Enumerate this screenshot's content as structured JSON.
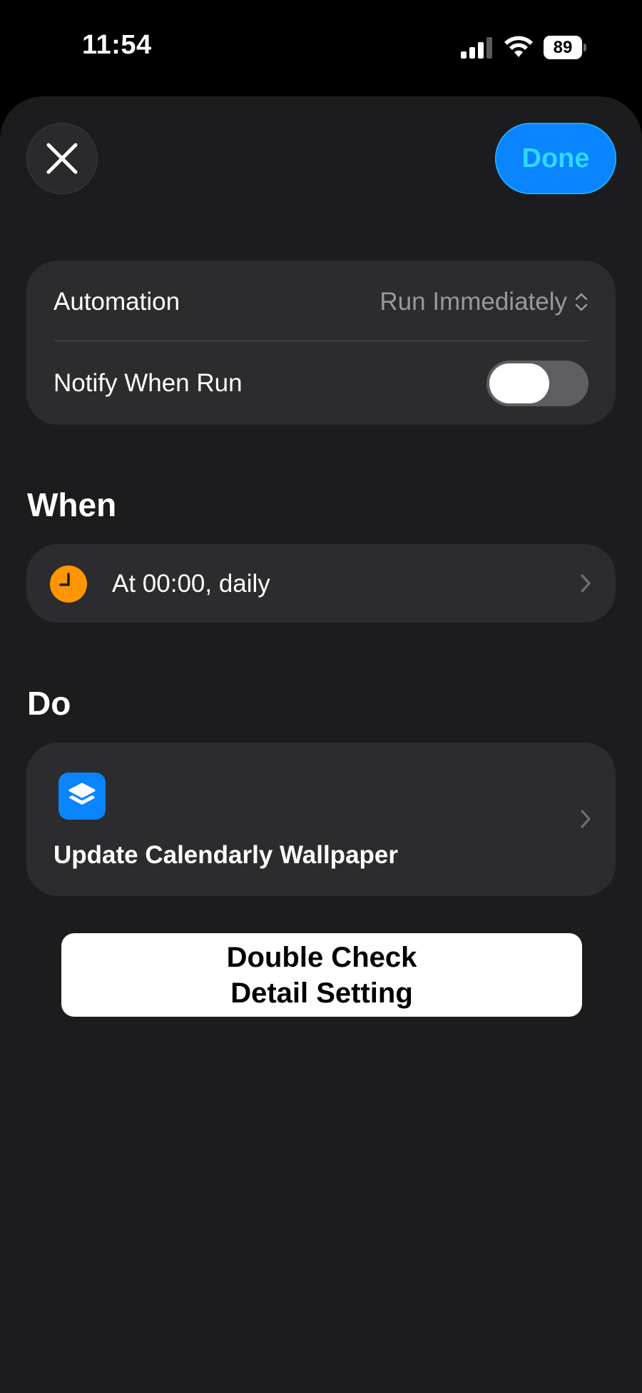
{
  "status_bar": {
    "time": "11:54",
    "battery": "89",
    "icons": [
      "cellular-signal-icon",
      "wifi-icon",
      "battery-icon"
    ]
  },
  "header": {
    "close_icon": "close-icon",
    "done_label": "Done"
  },
  "settings": {
    "automation_label": "Automation",
    "automation_value": "Run Immediately",
    "notify_label": "Notify When Run",
    "notify_enabled": false
  },
  "when": {
    "title": "When",
    "trigger_text": "At 00:00, daily",
    "icon": "clock-icon"
  },
  "do": {
    "title": "Do",
    "action_text": "Update Calendarly Wallpaper",
    "icon": "layers-app-icon"
  },
  "caption": {
    "line1": "Double Check",
    "line2": "Detail Setting"
  },
  "colors": {
    "accent": "#0a84ff",
    "done_text": "#33d6ff",
    "clock_orange": "#ff9500",
    "background": "#1c1c1e",
    "card": "#2c2c2e"
  }
}
